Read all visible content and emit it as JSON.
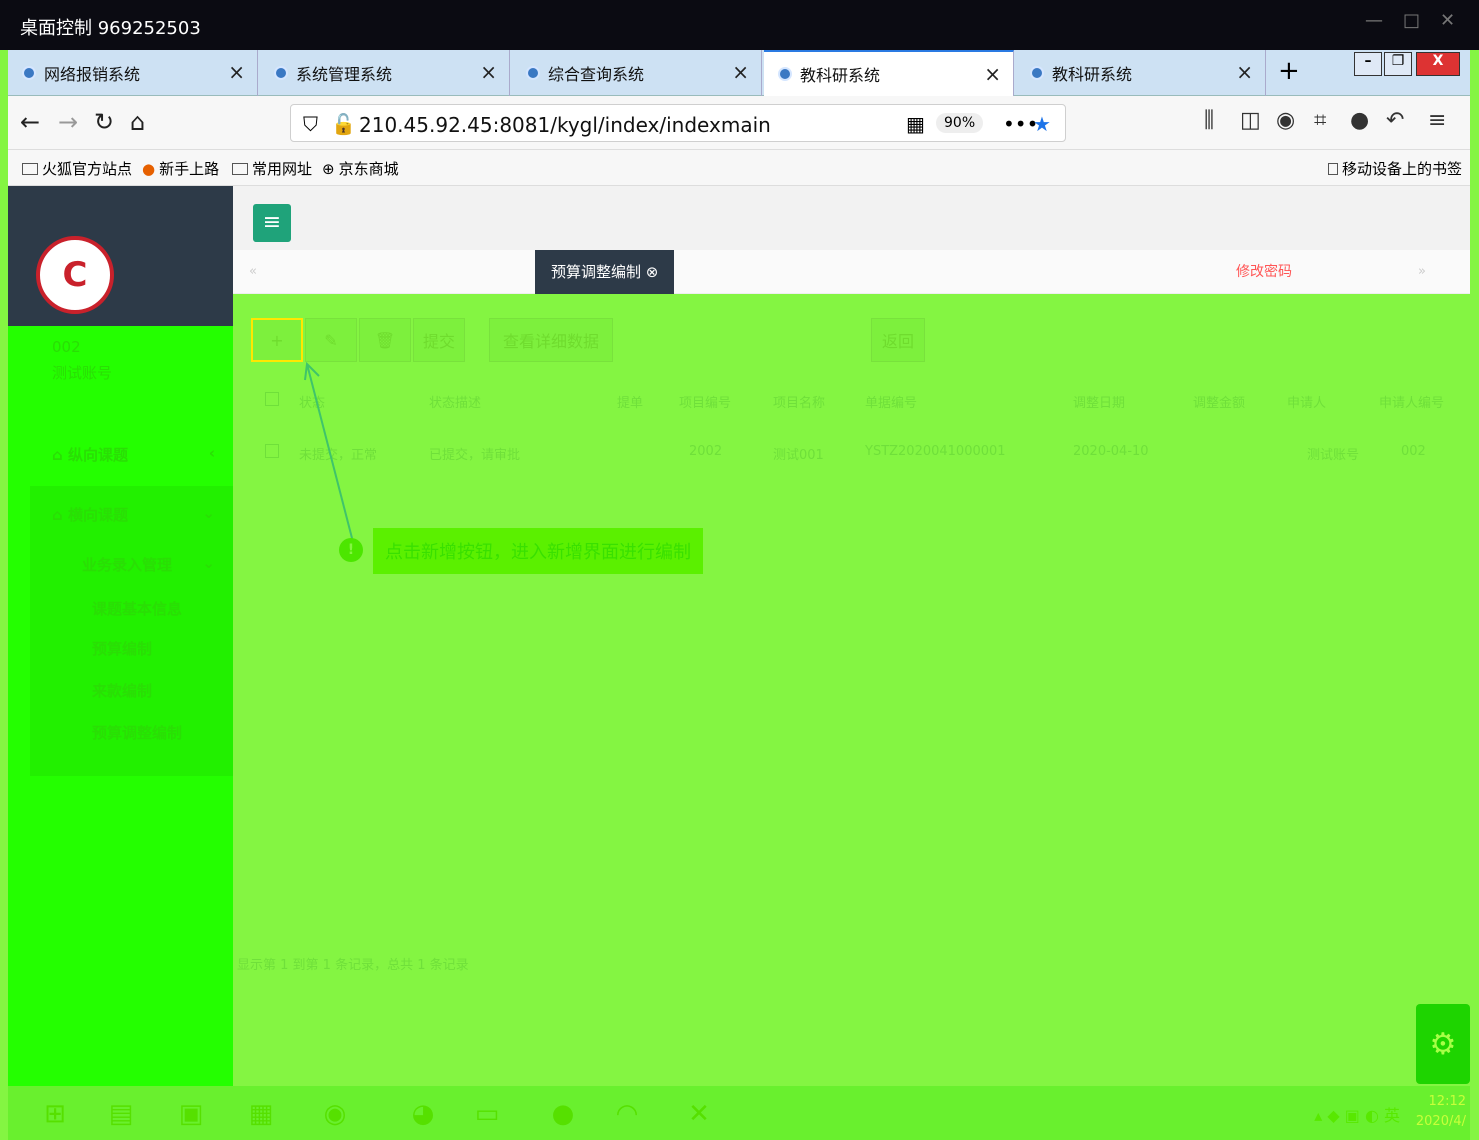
{
  "window": {
    "title": "桌面控制 969252503",
    "controls": [
      "—",
      "□",
      "✕"
    ]
  },
  "browser_tabs": [
    {
      "label": "网络报销系统",
      "active": false
    },
    {
      "label": "系统管理系统",
      "active": false
    },
    {
      "label": "综合查询系统",
      "active": false
    },
    {
      "label": "教科研系统",
      "active": true
    },
    {
      "label": "教科研系统",
      "active": false
    }
  ],
  "toolbar": {
    "url": "210.45.92.45:8081/kygl/index/indexmain",
    "zoom": "90%",
    "more": "•••"
  },
  "bookmarks": {
    "items": [
      "火狐官方站点",
      "新手上路",
      "常用网址",
      "京东商城"
    ],
    "mobile": "移动设备上的书签"
  },
  "sidebar": {
    "user_code": "002",
    "user_name": "测试账号",
    "menu": [
      {
        "label": "纵向课题",
        "chev": "‹"
      },
      {
        "label": "横向课题",
        "chev": "⌄"
      }
    ],
    "submenu_title": "业务录入管理",
    "submenu_items": [
      "课题基本信息",
      "预算编制",
      "来款编制",
      "预算调整编制"
    ]
  },
  "page_tabs": {
    "active": "预算调整编制",
    "red_link": "修改密码"
  },
  "actions": {
    "add": "+",
    "edit": "✎",
    "delete": "🗑",
    "submit": "提交",
    "view_detail": "查看详细数据",
    "back": "返回"
  },
  "table": {
    "headers": [
      "状态",
      "状态描述",
      "提单",
      "项目编号",
      "项目名称",
      "单据编号",
      "调整日期",
      "调整金额",
      "申请人",
      "申请人编号"
    ],
    "row": [
      "未提交，正常",
      "已提交，请审批",
      "",
      "2002",
      "测试001",
      "YSTZ2020041000001",
      "2020-04-10",
      "",
      "测试账号",
      "002"
    ]
  },
  "tip": "点击新增按钮，进入新增界面进行编制",
  "tip_icon": "!",
  "pager": "显示第 1 到第 1 条记录，总共 1 条记录",
  "clock": {
    "time": "12:12",
    "date": "2020/4/"
  },
  "colors": {
    "sidebar_dark": "#2d3a48",
    "accent": "#1fa37a",
    "overlay": "#84f542"
  }
}
